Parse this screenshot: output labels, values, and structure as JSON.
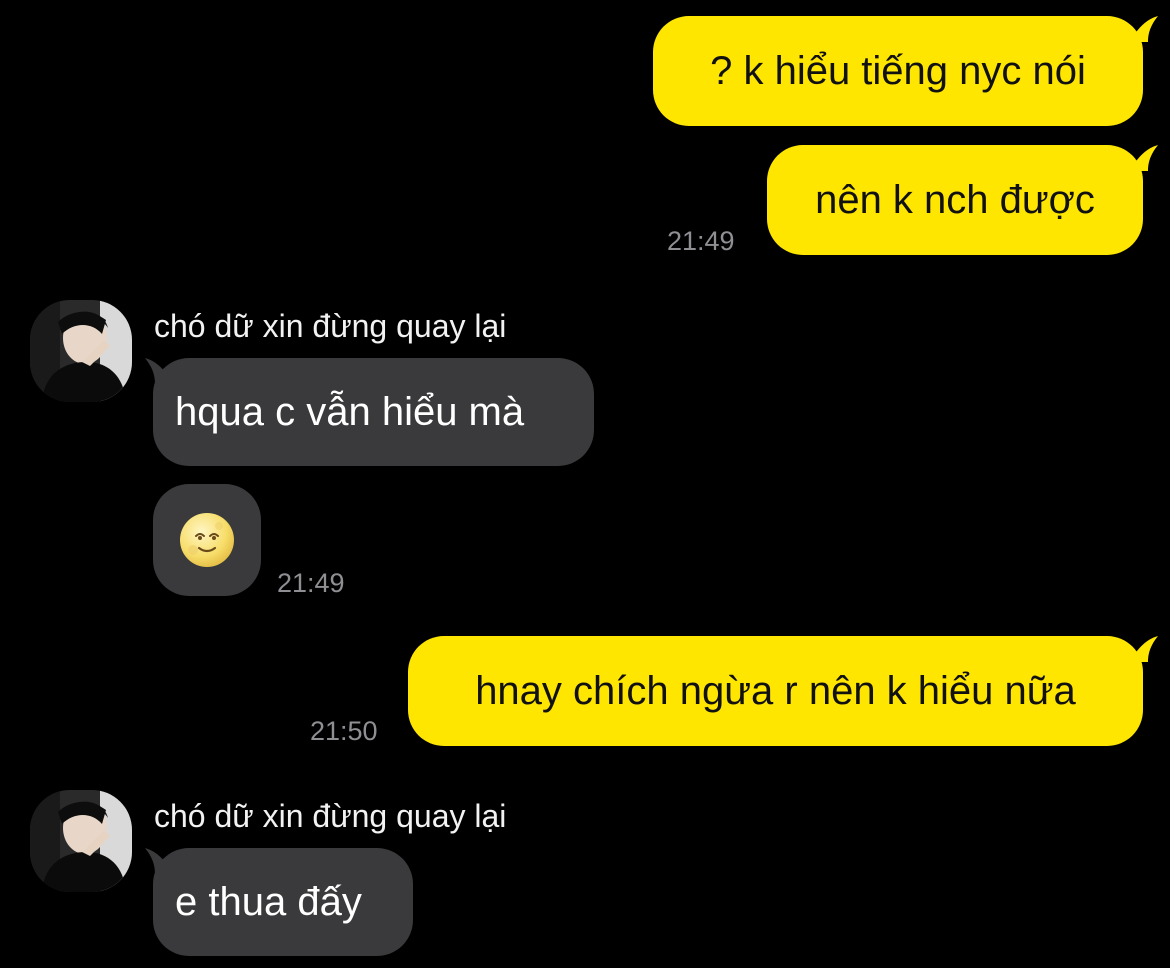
{
  "colors": {
    "background": "#000000",
    "outgoing_bubble": "#ffe600",
    "incoming_bubble": "#3a3a3c",
    "timestamp": "#8e8e93"
  },
  "messages": [
    {
      "id": "m1",
      "direction": "outgoing",
      "text": "? k hiểu tiếng nyc nói"
    },
    {
      "id": "m2",
      "direction": "outgoing",
      "text": "nên k nch được",
      "time": "21:49"
    },
    {
      "id": "m3",
      "direction": "incoming",
      "sender": "chó dữ xin đừng quay lại",
      "text": "hqua c vẫn hiểu mà"
    },
    {
      "id": "m4",
      "direction": "incoming",
      "emoji": "full-moon-face-icon",
      "time": "21:49"
    },
    {
      "id": "m5",
      "direction": "outgoing",
      "text": "hnay chích ngừa r nên k hiểu nữa",
      "time": "21:50"
    },
    {
      "id": "m6",
      "direction": "incoming",
      "sender": "chó dữ xin đừng quay lại",
      "text": "e thua đấy"
    }
  ]
}
